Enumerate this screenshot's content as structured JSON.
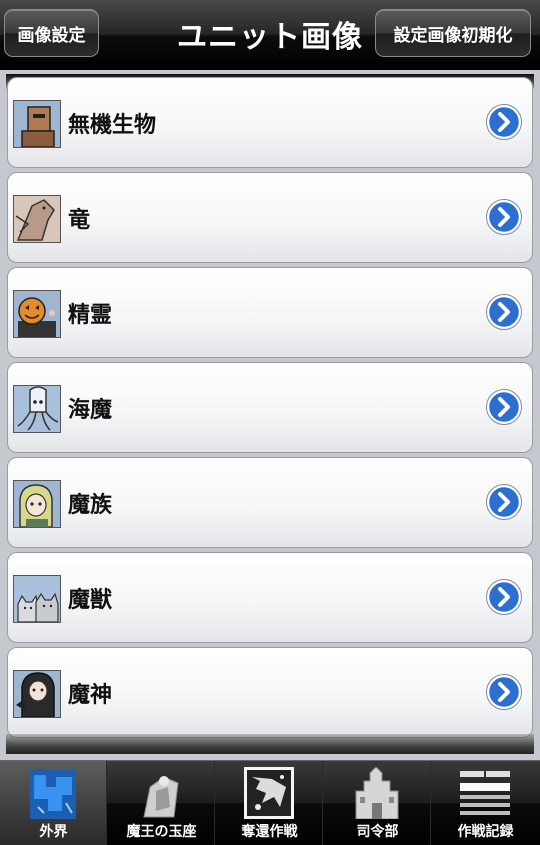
{
  "header": {
    "left_button": "画像設定",
    "title": "ユニット画像",
    "right_button": "設定画像初期化"
  },
  "list": {
    "items": [
      {
        "label": "無機生物",
        "icon": "golem-icon"
      },
      {
        "label": "竜",
        "icon": "dragon-icon"
      },
      {
        "label": "精霊",
        "icon": "pumpkin-icon"
      },
      {
        "label": "海魔",
        "icon": "squid-icon"
      },
      {
        "label": "魔族",
        "icon": "demon-girl-icon"
      },
      {
        "label": "魔獣",
        "icon": "cats-icon"
      },
      {
        "label": "魔神",
        "icon": "dark-goddess-icon"
      }
    ]
  },
  "tabs": [
    {
      "label": "外界",
      "icon": "outer-world-icon",
      "active": true
    },
    {
      "label": "魔王の玉座",
      "icon": "throne-icon",
      "active": false
    },
    {
      "label": "奪還作戦",
      "icon": "recapture-map-icon",
      "active": false
    },
    {
      "label": "司令部",
      "icon": "headquarters-icon",
      "active": false
    },
    {
      "label": "作戦記録",
      "icon": "records-icon",
      "active": false
    }
  ],
  "colors": {
    "accent_blue": "#2d6fd0",
    "header_black": "#000000",
    "list_bg": "#c5c8ce"
  }
}
